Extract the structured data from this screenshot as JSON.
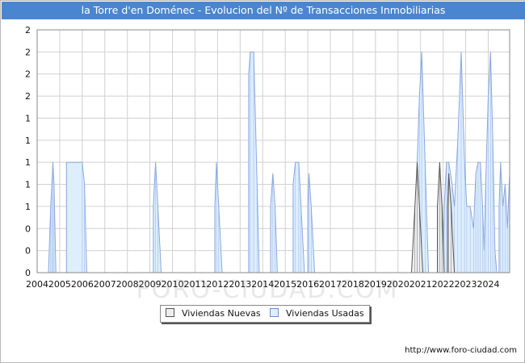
{
  "title": "la Torre d'en Doménec - Evolucion del Nº de Transacciones Inmobiliarias",
  "source": "http://www.foro-ciudad.com",
  "watermark": "FORO-CIUDAD.COM",
  "colors": {
    "title_bg": "#4a86d0",
    "nuevas_fill": "#eeeeee",
    "nuevas_stroke": "#555555",
    "usadas_fill": "#ddeeff",
    "usadas_stroke": "#8aa8e0",
    "grid": "#d0d0d0"
  },
  "legend": [
    {
      "label": "Viviendas Nuevas",
      "series": "nuevas"
    },
    {
      "label": "Viviendas Usadas",
      "series": "usadas"
    }
  ],
  "chart_data": {
    "type": "area",
    "title": "la Torre d'en Doménec - Evolucion del Nº de Transacciones Inmobiliarias",
    "xlabel": "",
    "ylabel": "",
    "x_tick_labels": [
      "2004",
      "2005",
      "2006",
      "2007",
      "2008",
      "2009",
      "2010",
      "2011",
      "2012",
      "2013",
      "2014",
      "2015",
      "2016",
      "2017",
      "2018",
      "2019",
      "2020",
      "2021",
      "2022",
      "2023",
      "2024"
    ],
    "xlim": [
      2004.0,
      2024.95
    ],
    "y_tick_labels": [
      "0",
      "0",
      "0",
      "1",
      "1",
      "1",
      "1",
      "1",
      "2",
      "2",
      "2",
      "2"
    ],
    "ylim": [
      0,
      2.2
    ],
    "grid": true,
    "legend_position": "bottom",
    "series": [
      {
        "name": "Viviendas Usadas",
        "key": "usadas",
        "points": [
          [
            2004.5,
            0
          ],
          [
            2004.6,
            0.6
          ],
          [
            2004.65,
            0.8
          ],
          [
            2004.7,
            1.0
          ],
          [
            2004.75,
            0.8
          ],
          [
            2004.83,
            0
          ],
          [
            2005.2,
            0
          ],
          [
            2005.3,
            1.0
          ],
          [
            2006.0,
            1.0
          ],
          [
            2006.1,
            0.8
          ],
          [
            2006.2,
            0
          ],
          [
            2009.0,
            0
          ],
          [
            2009.15,
            0.6
          ],
          [
            2009.25,
            1.0
          ],
          [
            2009.35,
            0.6
          ],
          [
            2009.5,
            0
          ],
          [
            2011.75,
            0
          ],
          [
            2011.88,
            0.6
          ],
          [
            2011.95,
            1.0
          ],
          [
            2012.05,
            0.6
          ],
          [
            2012.2,
            0
          ],
          [
            2013.25,
            0
          ],
          [
            2013.38,
            1.8
          ],
          [
            2013.45,
            2.0
          ],
          [
            2013.6,
            2.0
          ],
          [
            2013.75,
            0.8
          ],
          [
            2013.85,
            0
          ],
          [
            2014.25,
            0
          ],
          [
            2014.35,
            0.6
          ],
          [
            2014.45,
            0.9
          ],
          [
            2014.55,
            0.6
          ],
          [
            2014.65,
            0
          ],
          [
            2015.2,
            0
          ],
          [
            2015.35,
            0.8
          ],
          [
            2015.45,
            1.0
          ],
          [
            2015.6,
            1.0
          ],
          [
            2015.7,
            0.6
          ],
          [
            2015.85,
            0
          ],
          [
            2015.9,
            0
          ],
          [
            2016.0,
            0.6
          ],
          [
            2016.05,
            0.9
          ],
          [
            2016.15,
            0.6
          ],
          [
            2016.3,
            0
          ],
          [
            2020.7,
            0
          ],
          [
            2020.85,
            1.0
          ],
          [
            2020.95,
            1.6
          ],
          [
            2021.05,
            2.0
          ],
          [
            2021.2,
            1.0
          ],
          [
            2021.35,
            0
          ],
          [
            2021.6,
            0
          ],
          [
            2021.75,
            0.6
          ],
          [
            2021.85,
            0.8
          ],
          [
            2022.0,
            0.2
          ],
          [
            2022.05,
            0.6
          ],
          [
            2022.15,
            1.0
          ],
          [
            2022.25,
            1.0
          ],
          [
            2022.4,
            0.8
          ],
          [
            2022.5,
            0.6
          ],
          [
            2022.65,
            1.2
          ],
          [
            2022.8,
            2.0
          ],
          [
            2022.95,
            1.0
          ],
          [
            2023.05,
            0.6
          ],
          [
            2023.2,
            0.6
          ],
          [
            2023.35,
            0.4
          ],
          [
            2023.45,
            0.9
          ],
          [
            2023.55,
            1.0
          ],
          [
            2023.65,
            1.0
          ],
          [
            2023.75,
            0.6
          ],
          [
            2023.82,
            0.2
          ],
          [
            2023.9,
            0.9
          ],
          [
            2024.0,
            1.6
          ],
          [
            2024.1,
            2.0
          ],
          [
            2024.2,
            1.2
          ],
          [
            2024.3,
            0.2
          ],
          [
            2024.38,
            0
          ],
          [
            2024.48,
            0.6
          ],
          [
            2024.55,
            1.0
          ],
          [
            2024.65,
            0.6
          ],
          [
            2024.75,
            0.8
          ],
          [
            2024.85,
            0.4
          ],
          [
            2024.95,
            0.9
          ]
        ]
      },
      {
        "name": "Viviendas Nuevas",
        "key": "nuevas",
        "points": [
          [
            2020.6,
            0
          ],
          [
            2020.75,
            0.6
          ],
          [
            2020.85,
            1.0
          ],
          [
            2020.95,
            0.6
          ],
          [
            2021.1,
            0
          ],
          [
            2021.6,
            0
          ],
          [
            2021.75,
            0.6
          ],
          [
            2021.85,
            1.0
          ],
          [
            2021.95,
            0.6
          ],
          [
            2022.05,
            0
          ],
          [
            2022.1,
            0
          ],
          [
            2022.2,
            0.6
          ],
          [
            2022.25,
            0.9
          ],
          [
            2022.35,
            0.6
          ],
          [
            2022.5,
            0
          ]
        ]
      }
    ]
  }
}
